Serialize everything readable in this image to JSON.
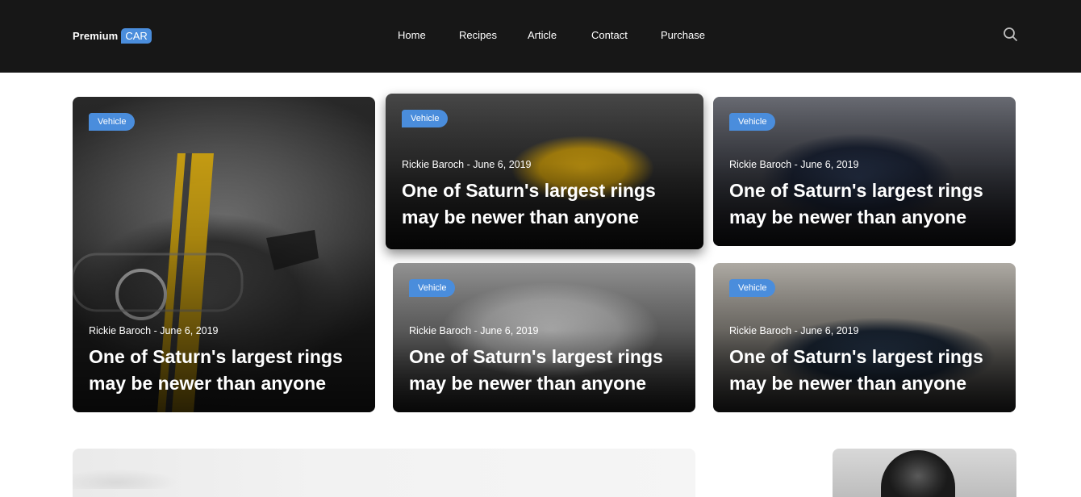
{
  "header": {
    "logo_text": "Premium",
    "logo_badge": "CAR",
    "nav": [
      "Home",
      "Recipes",
      "Article",
      "Contact",
      "Purchase"
    ],
    "search_icon": "search-icon"
  },
  "colors": {
    "header_bg": "#171717",
    "accent": "#4a8ddc",
    "text": "#ffffff"
  },
  "cards": [
    {
      "tag": "Vehicle",
      "meta": "Rickie Baroch - June 6, 2019",
      "title_line1": "One of Saturn's largest rings",
      "title_line2": "may be newer than anyone"
    },
    {
      "tag": "Vehicle",
      "meta": "Rickie Baroch - June 6, 2019",
      "title_line1": "One of Saturn's largest rings",
      "title_line2": "may be newer than anyone"
    },
    {
      "tag": "Vehicle",
      "meta": "Rickie Baroch - June 6, 2019",
      "title_line1": "One of Saturn's largest rings",
      "title_line2": "may be newer than anyone"
    },
    {
      "tag": "Vehicle",
      "meta": "Rickie Baroch - June 6, 2019",
      "title_line1": "One of Saturn's largest rings",
      "title_line2": "may be newer than anyone"
    },
    {
      "tag": "Vehicle",
      "meta": "Rickie Baroch - June 6, 2019",
      "title_line1": "One of Saturn's largest rings",
      "title_line2": "may be newer than anyone"
    }
  ]
}
